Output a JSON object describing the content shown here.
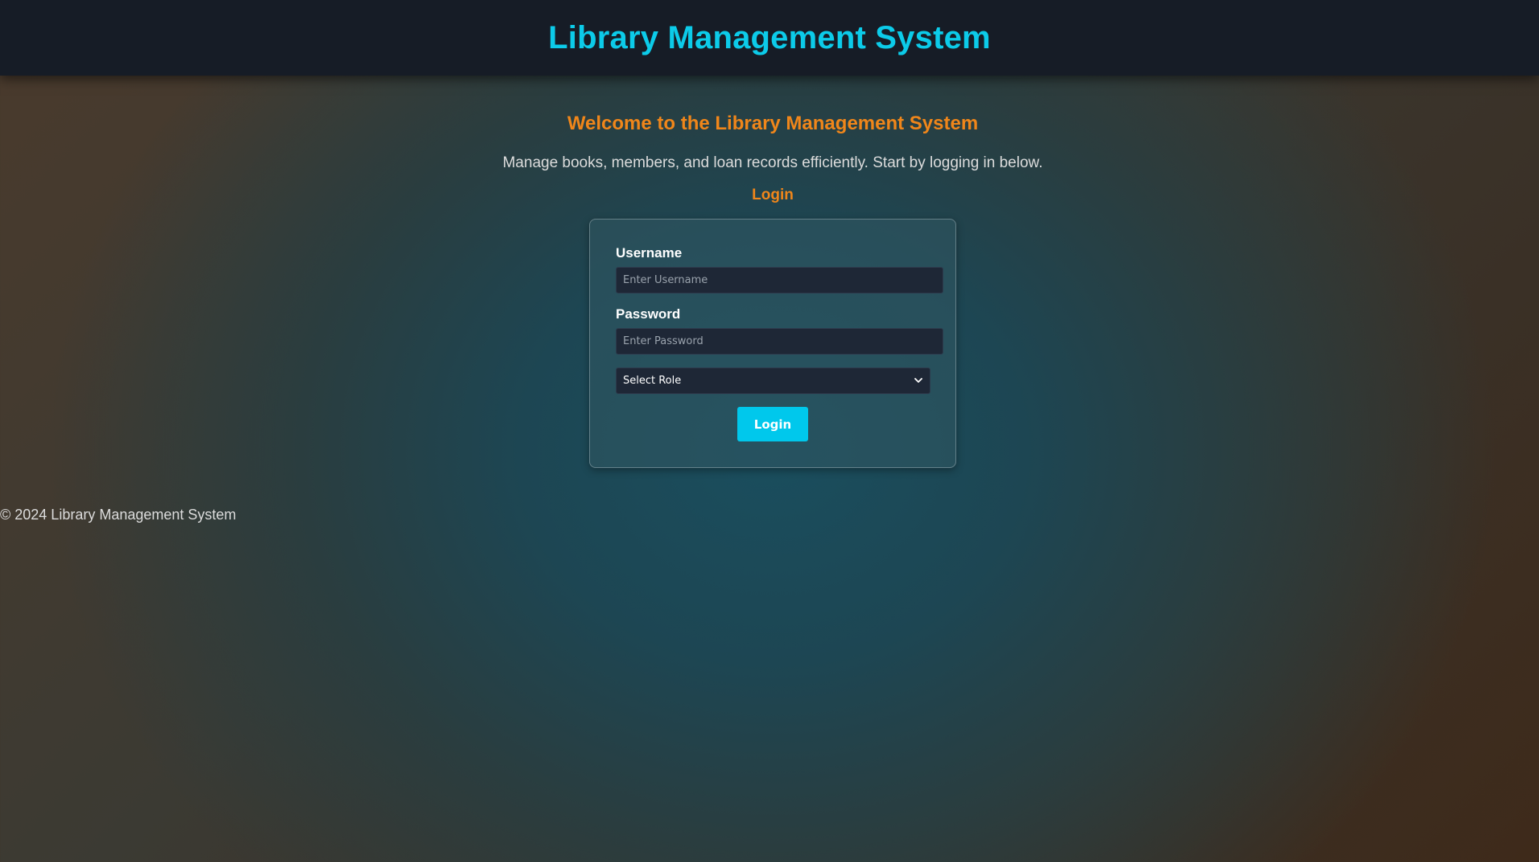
{
  "header": {
    "title": "Library Management System"
  },
  "main": {
    "welcome_title": "Welcome to the Library Management System",
    "subtitle": "Manage books, members, and loan records efficiently. Start by logging in below.",
    "login_heading": "Login"
  },
  "login_form": {
    "username_label": "Username",
    "username_value": "",
    "username_placeholder": "Enter Username",
    "password_label": "Password",
    "password_value": "",
    "password_placeholder": "Enter Password",
    "role_selected": "Select Role",
    "submit_label": "Login"
  },
  "footer": {
    "copyright": "© 2024 Library Management System"
  },
  "colors": {
    "brand_cyan": "#0ccbe9",
    "accent_orange": "#f0861a",
    "button_cyan": "#00c8ec",
    "topbar_bg": "#161c26",
    "input_bg": "#1e2736"
  },
  "icons": {
    "role_dropdown": "chevron-down-icon"
  }
}
